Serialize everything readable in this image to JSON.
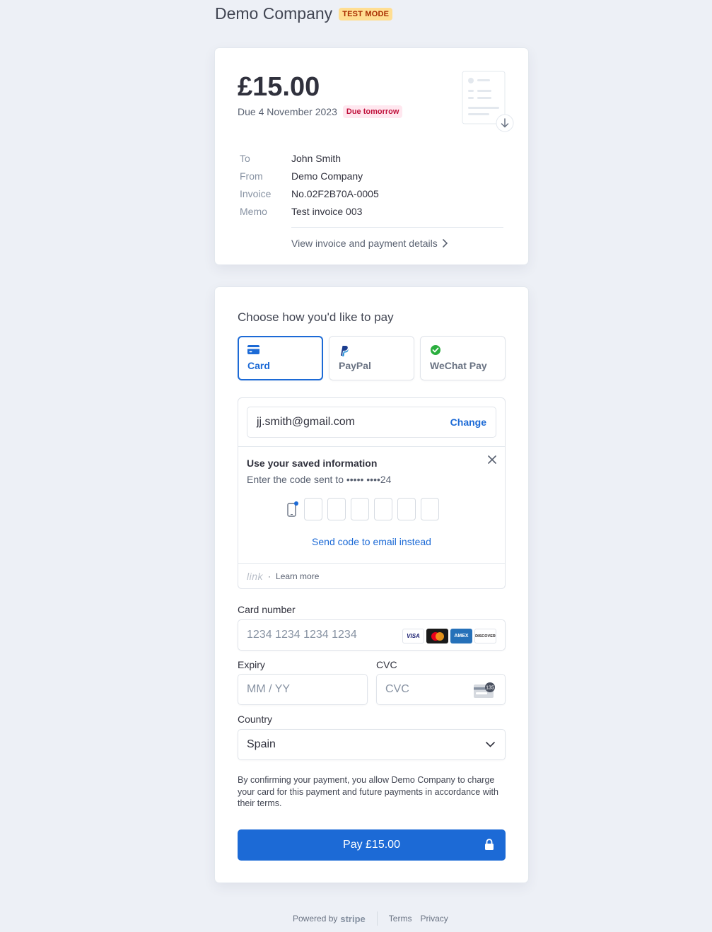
{
  "header": {
    "company": "Demo Company",
    "mode_badge": "TEST MODE"
  },
  "invoice": {
    "amount": "£15.00",
    "due_text": "Due 4 November 2023",
    "due_badge": "Due tomorrow",
    "rows": [
      {
        "label": "To",
        "value": "John Smith"
      },
      {
        "label": "From",
        "value": "Demo Company"
      },
      {
        "label": "Invoice",
        "value": "No.02F2B70A-0005"
      },
      {
        "label": "Memo",
        "value": "Test invoice 003"
      }
    ],
    "view_link": "View invoice and payment details",
    "download_icon": "download-arrow-icon"
  },
  "payment": {
    "title": "Choose how you'd like to pay",
    "methods": [
      {
        "label": "Card",
        "icon": "card-icon",
        "selected": true
      },
      {
        "label": "PayPal",
        "icon": "paypal-icon",
        "selected": false
      },
      {
        "label": "WeChat Pay",
        "icon": "wechat-icon",
        "selected": false
      }
    ],
    "link": {
      "email": "jj.smith@gmail.com",
      "change_label": "Change",
      "saved_title": "Use your saved information",
      "saved_sub": "Enter the code sent to ••••• ••••24",
      "code_slots": 6,
      "send_email_label": "Send code to email instead",
      "logo_text": "link",
      "separator": "·",
      "learn_more": "Learn more"
    },
    "card_number": {
      "label": "Card number",
      "placeholder": "1234 1234 1234 1234",
      "brands": [
        "VISA",
        "Mastercard",
        "AMEX",
        "DISCOVER"
      ]
    },
    "expiry": {
      "label": "Expiry",
      "placeholder": "MM / YY"
    },
    "cvc": {
      "label": "CVC",
      "placeholder": "CVC",
      "badge": "135"
    },
    "country": {
      "label": "Country",
      "value": "Spain"
    },
    "consent": "By confirming your payment, you allow Demo Company to charge your card for this payment and future payments in accordance with their terms.",
    "pay_button": "Pay £15.00"
  },
  "footer": {
    "powered_by": "Powered by",
    "stripe": "stripe",
    "terms": "Terms",
    "privacy": "Privacy"
  },
  "colors": {
    "accent": "#1c6ad6",
    "background": "#edf0f6",
    "test_badge": "#ffde92",
    "due_badge": "#ffe7ef"
  }
}
